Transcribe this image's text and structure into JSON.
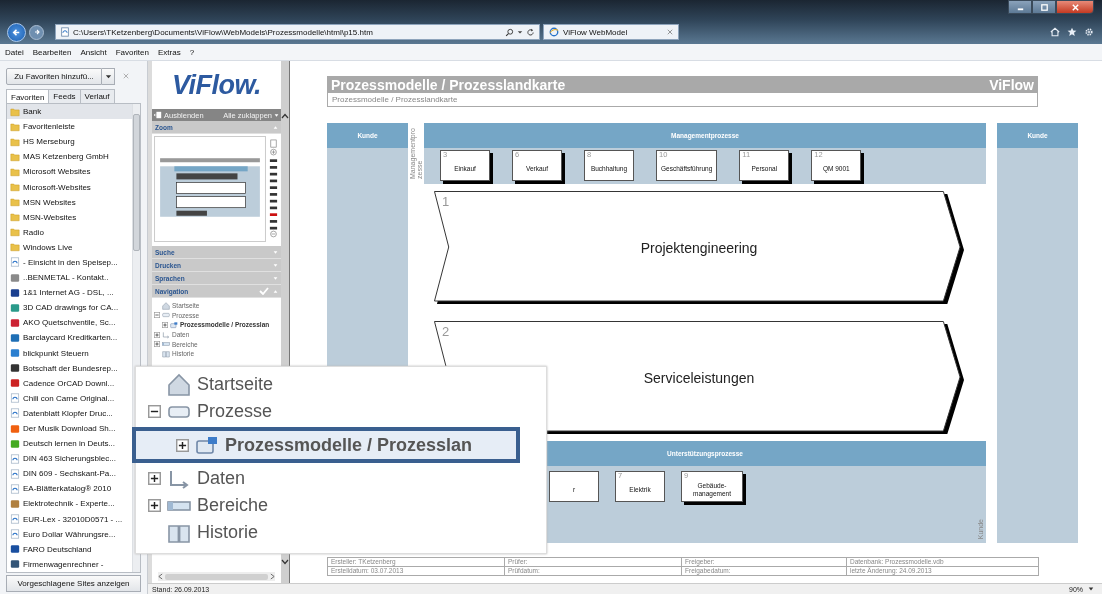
{
  "browser": {
    "address": "C:\\Users\\TKetzenberg\\Documents\\ViFlow\\WebModels\\Prozessmodelle\\html\\p15.htm",
    "tab": "ViFlow WebModel"
  },
  "menu": [
    "Datei",
    "Bearbeiten",
    "Ansicht",
    "Favoriten",
    "Extras",
    "?"
  ],
  "favorites": {
    "add_button": "Zu Favoriten hinzufü...",
    "tabs": [
      {
        "label": "Favoriten",
        "selected": true
      },
      {
        "label": "Feeds",
        "selected": false
      },
      {
        "label": "Verlauf",
        "selected": false
      }
    ],
    "items": [
      {
        "label": "Bank",
        "kind": "folder",
        "selected": true
      },
      {
        "label": "Favoritenleiste",
        "kind": "folder",
        "selected": false
      },
      {
        "label": "HS Merseburg",
        "kind": "folder",
        "selected": false
      },
      {
        "label": "MAS Ketzenberg GmbH",
        "kind": "folder",
        "selected": false
      },
      {
        "label": "Microsoft Websites",
        "kind": "folder",
        "selected": false
      },
      {
        "label": "Microsoft-Websites",
        "kind": "folder",
        "selected": false
      },
      {
        "label": "MSN Websites",
        "kind": "folder",
        "selected": false
      },
      {
        "label": "MSN-Websites",
        "kind": "folder",
        "selected": false
      },
      {
        "label": "Radio",
        "kind": "folder",
        "selected": false
      },
      {
        "label": "Windows Live",
        "kind": "folder",
        "selected": false
      },
      {
        "label": "- Einsicht in den Speisep...",
        "kind": "page",
        "selected": false
      },
      {
        "label": "..BENMETAL - Kontakt..",
        "kind": "site",
        "color": "#8a8a8a",
        "selected": false
      },
      {
        "label": "1&1 Internet AG - DSL, ...",
        "kind": "site",
        "color": "#1a3f8f",
        "selected": false
      },
      {
        "label": "3D CAD drawings for CA...",
        "kind": "site",
        "color": "#2a9a8a",
        "selected": false
      },
      {
        "label": "AKO Quetschventile, Sc...",
        "kind": "site",
        "color": "#cc2233",
        "selected": false
      },
      {
        "label": "Barclaycard Kreditkarten...",
        "kind": "site",
        "color": "#1f6fb5",
        "selected": false
      },
      {
        "label": "blickpunkt Steuern",
        "kind": "site",
        "color": "#2a7fd0",
        "selected": false
      },
      {
        "label": "Botschaft der Bundesrep...",
        "kind": "site",
        "color": "#333333",
        "selected": false
      },
      {
        "label": "Cadence OrCAD Downl...",
        "kind": "site",
        "color": "#cc2222",
        "selected": false
      },
      {
        "label": "Chili con Carne Original...",
        "kind": "page",
        "selected": false
      },
      {
        "label": "Datenblatt Klopfer Druc...",
        "kind": "page",
        "selected": false
      },
      {
        "label": "Der Musik Download Sh...",
        "kind": "site",
        "color": "#f06010",
        "selected": false
      },
      {
        "label": "Deutsch lernen in Deuts...",
        "kind": "site",
        "color": "#44aa22",
        "selected": false
      },
      {
        "label": "DIN 463 Sicherungsblec...",
        "kind": "page",
        "selected": false
      },
      {
        "label": "DIN 609 - Sechskant-Pa...",
        "kind": "page",
        "selected": false
      },
      {
        "label": "EA-Blätterkatalog® 2010",
        "kind": "page",
        "selected": false
      },
      {
        "label": "Elektrotechnik - Experte...",
        "kind": "site",
        "color": "#b08040",
        "selected": false
      },
      {
        "label": "EUR-Lex - 32010D0571 - ...",
        "kind": "page",
        "selected": false
      },
      {
        "label": "Euro Dollar Währungsre...",
        "kind": "page",
        "selected": false
      },
      {
        "label": "FARO Deutschland",
        "kind": "site",
        "color": "#1a4fa0",
        "selected": false
      },
      {
        "label": "Firmenwagenrechner -",
        "kind": "site",
        "color": "#335577",
        "selected": false
      }
    ],
    "footer_button": "Vorgeschlagene Sites anzeigen"
  },
  "viflow_panel": {
    "logo": "ViFlow.",
    "hide_button": "Ausblenden",
    "collapse_button": "Alle zuklappen",
    "sections": [
      {
        "label": "Zoom",
        "expanded": true,
        "checked": false
      },
      {
        "label": "Suche",
        "expanded": false,
        "checked": false
      },
      {
        "label": "Drucken",
        "expanded": false,
        "checked": false
      },
      {
        "label": "Sprachen",
        "expanded": false,
        "checked": false
      },
      {
        "label": "Navigation",
        "expanded": true,
        "checked": true
      }
    ],
    "zoom_slider": {
      "level": 0.2
    },
    "navigation_tree": [
      {
        "label": "Startseite",
        "kind": "home",
        "selected": false
      },
      {
        "label": "Prozesse",
        "kind": "folder",
        "expanded": true,
        "selected": false,
        "children": [
          {
            "label": "Prozessmodelle / Prozesslan",
            "kind": "model",
            "expanded": false,
            "selected": true
          }
        ]
      },
      {
        "label": "Daten",
        "kind": "data",
        "expanded": false,
        "selected": false
      },
      {
        "label": "Bereiche",
        "kind": "area",
        "expanded": false,
        "selected": false
      },
      {
        "label": "Historie",
        "kind": "history",
        "selected": false
      }
    ]
  },
  "magnifier": {
    "items": [
      {
        "label": "Startseite",
        "kind": "home",
        "selected": false
      },
      {
        "label": "Prozesse",
        "kind": "folder",
        "expanded": true,
        "selected": false,
        "children": [
          {
            "label": "Prozessmodelle / Prozesslan",
            "kind": "model",
            "expanded": false,
            "selected": true
          }
        ]
      },
      {
        "label": "Daten",
        "kind": "data",
        "expanded": false,
        "selected": false
      },
      {
        "label": "Bereiche",
        "kind": "area",
        "expanded": false,
        "selected": false
      },
      {
        "label": "Historie",
        "kind": "history",
        "selected": false
      }
    ]
  },
  "page": {
    "title": "Prozessmodelle / Prozesslandkarte",
    "brand": "ViFlow",
    "breadcrumb": "Prozessmodelle / Prozesslandkarte",
    "customer_left": "Kunde",
    "customer_right": "Kunde",
    "management": {
      "title": "Managementprozesse",
      "side_label": "Managementprozesse",
      "processes": [
        {
          "number": "3",
          "label": "Einkauf",
          "shadow": true
        },
        {
          "number": "6",
          "label": "Verkauf",
          "shadow": true
        },
        {
          "number": "8",
          "label": "Buchhaltung",
          "shadow": false
        },
        {
          "number": "10",
          "label": "Geschäftsführung",
          "shadow": false
        },
        {
          "number": "11",
          "label": "Personal",
          "shadow": true
        },
        {
          "number": "12",
          "label": "QM 9001",
          "shadow": true
        }
      ]
    },
    "core_processes": [
      {
        "number": "1",
        "label": "Projektengineering"
      },
      {
        "number": "2",
        "label": "Serviceleistungen"
      }
    ],
    "support": {
      "title": "Unterstützungsprozesse",
      "side_label": "Kunde",
      "processes": [
        {
          "label": "r",
          "shadow": false
        },
        {
          "number": "7",
          "label": "Elektrik",
          "shadow": false
        },
        {
          "number": "9",
          "label": "Gebäude-management",
          "shadow": true
        }
      ]
    },
    "footer": [
      [
        "Ersteller: TKetzenberg",
        "Prüfer:",
        "Freigeber:",
        "Datenbank: Prozessmodelle.vdb"
      ],
      [
        "Erstelldatum: 03.07.2013",
        "Prüfdatum:",
        "Freigabedatum:",
        "letzte Änderung: 24.09.2013"
      ]
    ]
  },
  "status_bar": {
    "text": "Stand: 26.09.2013",
    "zoom": "90%"
  }
}
